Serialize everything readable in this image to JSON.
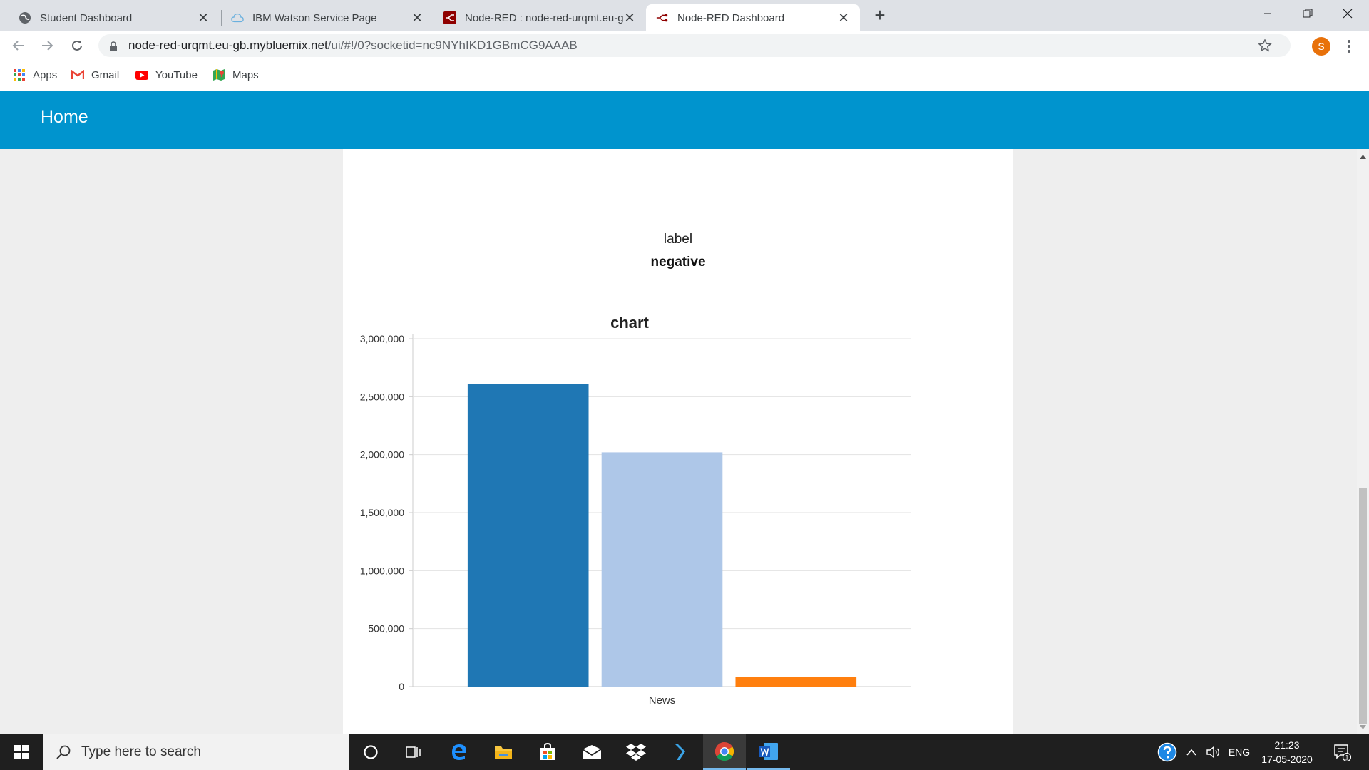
{
  "browser": {
    "tabs": [
      {
        "title": "Student Dashboard",
        "icon": "globe-icon",
        "active": false
      },
      {
        "title": "IBM Watson Service Page",
        "icon": "cloud-icon",
        "active": false
      },
      {
        "title": "Node-RED : node-red-urqmt.eu-gb.mybluemix.net",
        "icon": "node-red-icon",
        "active": false
      },
      {
        "title": "Node-RED Dashboard",
        "icon": "node-red-icon",
        "active": true
      }
    ],
    "close_glyph": "✕",
    "new_tab_glyph": "+",
    "url_host": "node-red-urqmt.eu-gb.mybluemix.net",
    "url_path": "/ui/#!/0?socketid=nc9NYhIKD1GBmCG9AAAB",
    "profile_initial": "S",
    "bookmarks": [
      {
        "label": "Apps",
        "icon": "apps-grid-icon"
      },
      {
        "label": "Gmail",
        "icon": "gmail-icon"
      },
      {
        "label": "YouTube",
        "icon": "youtube-icon"
      },
      {
        "label": "Maps",
        "icon": "maps-icon"
      }
    ]
  },
  "dashboard": {
    "title": "Home",
    "text_widget": {
      "label": "label",
      "value": "negative"
    },
    "colors": {
      "header": "#0094ce"
    }
  },
  "chart_data": {
    "type": "bar",
    "title": "chart",
    "categories": [
      "News"
    ],
    "series": [
      {
        "values": [
          2610000
        ],
        "color": "#1f77b4"
      },
      {
        "values": [
          2020000
        ],
        "color": "#aec7e8"
      },
      {
        "values": [
          80000
        ],
        "color": "#ff7f0e"
      }
    ],
    "ylim": [
      0,
      3000000
    ],
    "yticks": [
      0,
      500000,
      1000000,
      1500000,
      2000000,
      2500000,
      3000000
    ],
    "ytick_labels": [
      "0",
      "500,000",
      "1,000,000",
      "1,500,000",
      "2,000,000",
      "2,500,000",
      "3,000,000"
    ],
    "grid": true,
    "legend": "none",
    "xlabel": "",
    "ylabel": ""
  },
  "taskbar": {
    "search_placeholder": "Type here to search",
    "apps": [
      "cortana-circle-icon",
      "task-view-icon",
      "edge-icon",
      "file-explorer-icon",
      "store-icon",
      "mail-icon",
      "dropbox-icon",
      "visual-studio-icon",
      "chrome-icon",
      "word-icon"
    ],
    "language": "ENG",
    "time": "21:23",
    "date": "17-05-2020",
    "notification_count": "1"
  }
}
